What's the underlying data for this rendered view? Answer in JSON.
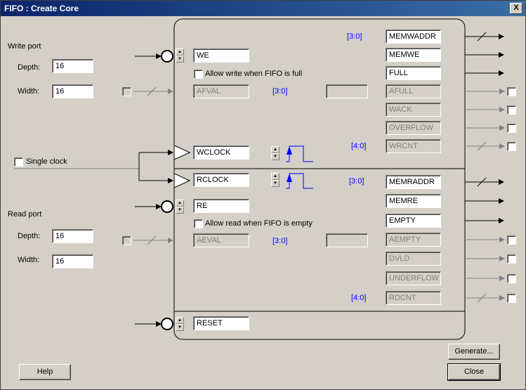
{
  "window": {
    "title": "FIFO : Create Core",
    "close_glyph": "X"
  },
  "write_port": {
    "heading": "Write port",
    "depth_label": "Depth:",
    "depth": "16",
    "width_label": "Width:",
    "width": "16"
  },
  "read_port": {
    "heading": "Read port",
    "depth_label": "Depth:",
    "depth": "16",
    "width_label": "Width:",
    "width": "16"
  },
  "single_clock": {
    "label": "Single clock",
    "checked": false
  },
  "write_side": {
    "we": "WE",
    "allow_write_full": "Allow write when FIFO is full",
    "afval": "AFVAL",
    "afval_range": "[3:0]",
    "wclock": "WCLOCK",
    "wrcnt_range": "[4:0]",
    "memwaddr_range": "[3:0]"
  },
  "read_side": {
    "rclock": "RCLOCK",
    "re": "RE",
    "allow_read_empty": "Allow read when FIFO is empty",
    "aeval": "AEVAL",
    "aeval_range": "[3:0]",
    "rdcnt_range": "[4:0]",
    "memraddr_range": "[3:0]"
  },
  "reset": "RESET",
  "outputs_write": [
    "MEMWADDR",
    "MEMWE",
    "FULL",
    "AFULL",
    "WACK",
    "OVERFLOW",
    "WRCNT"
  ],
  "outputs_read": [
    "MEMRADDR",
    "MEMRE",
    "EMPTY",
    "AEMPTY",
    "DVLD",
    "UNDERFLOW",
    "RDCNT"
  ],
  "buttons": {
    "generate": "Generate...",
    "help": "Help",
    "close": "Close"
  },
  "colors": {
    "titlebar": "#0a246a",
    "accent_blue": "#0000ff",
    "disabled": "#808080"
  }
}
